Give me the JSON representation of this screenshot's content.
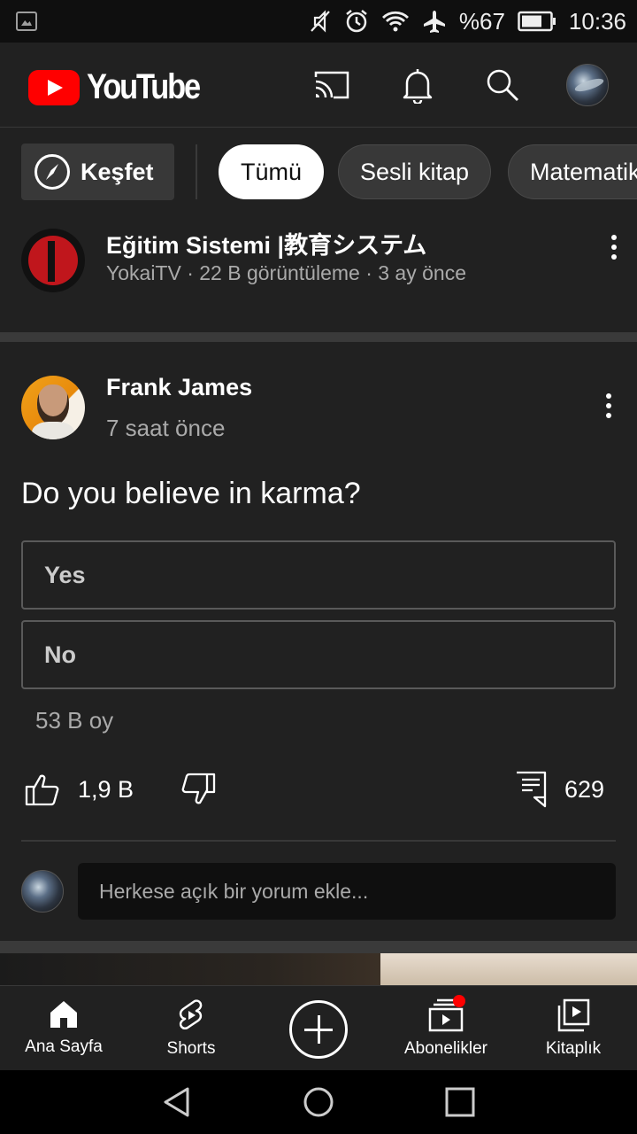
{
  "status_bar": {
    "battery": "%67",
    "time": "10:36"
  },
  "header": {
    "logo_text": "YouTube",
    "brand_color": "#ff0000"
  },
  "chips": {
    "explore_label": "Keşfet",
    "items": [
      {
        "label": "Tümü",
        "selected": true
      },
      {
        "label": "Sesli kitap",
        "selected": false
      },
      {
        "label": "Matematik",
        "selected": false
      }
    ]
  },
  "video": {
    "title": "Eğitim Sistemi |教育システム",
    "meta": "YokaiTV · 22 B görüntüleme · 3 ay önce"
  },
  "post": {
    "author": "Frank James",
    "time": "7 saat önce",
    "question": "Do you believe in karma?",
    "options": [
      {
        "label": "Yes"
      },
      {
        "label": "No"
      }
    ],
    "votes": "53 B oy",
    "likes": "1,9 B",
    "comments": "629",
    "comment_placeholder": "Herkese açık bir yorum ekle..."
  },
  "bottom_nav": {
    "items": [
      {
        "label": "Ana Sayfa",
        "icon": "home-icon"
      },
      {
        "label": "Shorts",
        "icon": "shorts-icon"
      },
      {
        "label": "",
        "icon": "create-icon"
      },
      {
        "label": "Abonelikler",
        "icon": "subscriptions-icon"
      },
      {
        "label": "Kitaplık",
        "icon": "library-icon"
      }
    ]
  }
}
